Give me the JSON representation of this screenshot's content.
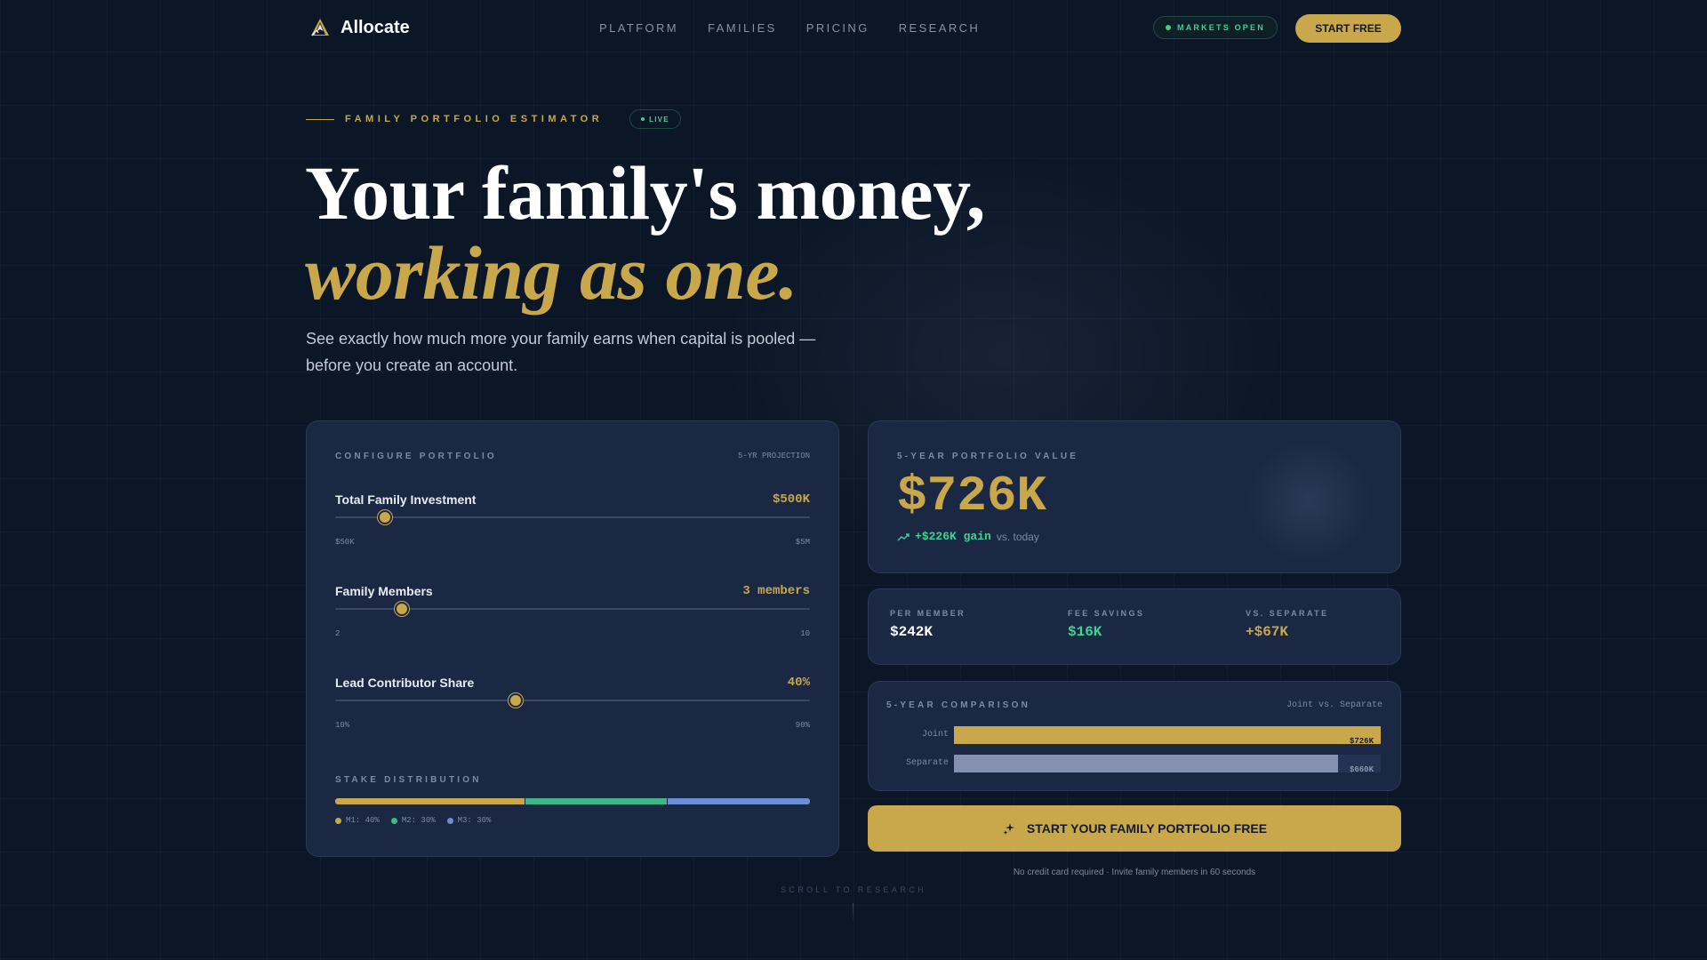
{
  "brand": {
    "name": "Allocate"
  },
  "nav": {
    "links": [
      "PLATFORM",
      "FAMILIES",
      "PRICING",
      "RESEARCH"
    ],
    "status": "MARKETS OPEN",
    "cta": "START FREE"
  },
  "hero": {
    "eyebrow": "FAMILY PORTFOLIO ESTIMATOR",
    "live": "LIVE",
    "headline_line1": "Your family's money,",
    "headline_line2": "working as one.",
    "subtitle": "See exactly how much more your family earns when capital is pooled — before you create an account."
  },
  "config": {
    "title": "CONFIGURE PORTFOLIO",
    "tag": "5-YR PROJECTION",
    "sliders": [
      {
        "label": "Total Family Investment",
        "value": "$500K",
        "min": "$50K",
        "max": "$5M",
        "fraction": 0.105
      },
      {
        "label": "Family Members",
        "value": "3 members",
        "min": "2",
        "max": "10",
        "fraction": 0.14
      },
      {
        "label": "Lead Contributor Share",
        "value": "40%",
        "min": "10%",
        "max": "90%",
        "fraction": 0.38
      }
    ],
    "stake": {
      "title": "STAKE DISTRIBUTION",
      "segments": [
        {
          "label": "M1: 40%",
          "percent": 40,
          "color": "#c9a84c"
        },
        {
          "label": "M2: 30%",
          "percent": 30,
          "color": "#3eb887"
        },
        {
          "label": "M3: 30%",
          "percent": 30,
          "color": "#6b8fd6"
        }
      ]
    }
  },
  "projection": {
    "title": "5-YEAR PORTFOLIO VALUE",
    "value": "$726K",
    "gain": "+$226K gain",
    "gain_vs": "vs. today"
  },
  "stats": [
    {
      "label": "PER MEMBER",
      "value": "$242K",
      "color": "#ffffff"
    },
    {
      "label": "FEE SAVINGS",
      "value": "$16K",
      "color": "#3ed38f"
    },
    {
      "label": "VS. SEPARATE",
      "value": "+$67K",
      "color": "#c9a84c"
    }
  ],
  "comparison": {
    "title": "5-YEAR COMPARISON",
    "tag": "Joint vs. Separate",
    "rows": [
      {
        "label": "Joint",
        "value": "$726K",
        "fraction": 1.0,
        "color": "#c9a84c",
        "text_color": "#1a1f2a"
      },
      {
        "label": "Separate",
        "value": "$660K",
        "fraction": 0.9,
        "color": "#8590b0",
        "text_color": "#8a94ab"
      }
    ]
  },
  "cta": {
    "label": "START YOUR FAMILY PORTFOLIO FREE",
    "note": "No credit card required · Invite family members in 60 seconds"
  },
  "scroll_hint": "SCROLL TO RESEARCH",
  "colors": {
    "accent": "#c9a84c",
    "positive": "#3ed38f",
    "background": "#0b1626",
    "card": "#1b2844"
  }
}
